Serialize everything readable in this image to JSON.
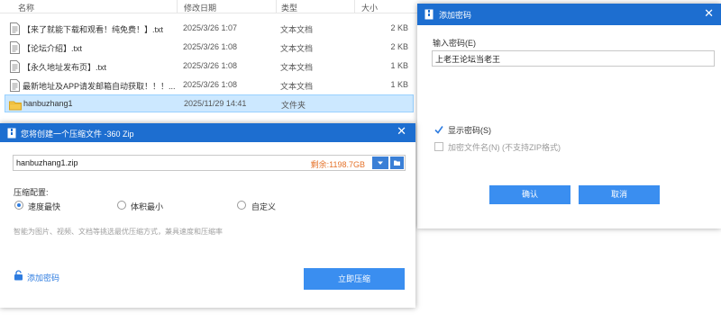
{
  "explorer": {
    "columns": [
      "名称",
      "修改日期",
      "类型",
      "大小"
    ],
    "rows": [
      {
        "name": "【来了就能下载和观看！纯免费！】.txt",
        "date": "2025/3/26 1:07",
        "type": "文本文档",
        "size": "2 KB",
        "icon": "txt-file-icon"
      },
      {
        "name": "【论坛介绍】.txt",
        "date": "2025/3/26 1:08",
        "type": "文本文档",
        "size": "2 KB",
        "icon": "txt-file-icon"
      },
      {
        "name": "【永久地址发布页】.txt",
        "date": "2025/3/26 1:08",
        "type": "文本文档",
        "size": "1 KB",
        "icon": "txt-file-icon"
      },
      {
        "name": "最新地址及APP请发邮箱自动获取！！！...",
        "date": "2025/3/26 1:08",
        "type": "文本文档",
        "size": "1 KB",
        "icon": "txt-file-icon"
      },
      {
        "name": "hanbuzhang1",
        "date": "2025/11/29 14:41",
        "type": "文件夹",
        "size": "",
        "icon": "folder-icon"
      }
    ]
  },
  "password_dialog": {
    "title": "添加密码",
    "label": "输入密码(E)",
    "value": "上老王论坛当老王",
    "show_password": "显示密码(S)",
    "encrypt_names": "加密文件名(N) (不支持ZIP格式)",
    "ok": "确认",
    "cancel": "取消"
  },
  "zip_dialog": {
    "title": "您将创建一个压缩文件 -360 Zip",
    "filename": "hanbuzhang1.zip",
    "free_space": "剩余:1198.7GB",
    "config_label": "压缩配置:",
    "options": [
      "速度最快",
      "体积最小",
      "自定义"
    ],
    "selected_option": "速度最快",
    "hint": "智能为图片、视频、文档等挑选最优压缩方式，兼具速度和压缩率",
    "add_password": "添加密码",
    "compress_now": "立即压缩"
  },
  "colors": {
    "titlebar": "#1d6ed0",
    "button": "#3a8ef0",
    "selection": "#cce8ff",
    "free_space": "#e5722a",
    "link": "#2e7ce0"
  }
}
